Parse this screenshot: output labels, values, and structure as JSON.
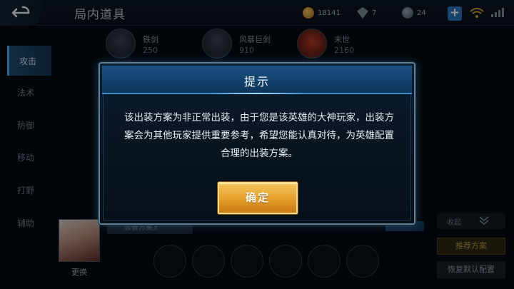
{
  "header": {
    "title": "局内道具",
    "resources": {
      "gold": "18141",
      "gems": "7",
      "vouchers": "24"
    },
    "icons": {
      "back": "back-arrow-icon",
      "gold": "gold-coin-icon",
      "gems": "diamond-icon",
      "vouchers": "voucher-icon",
      "plus": "plus-icon",
      "wifi": "wifi-icon",
      "signal": "signal-icon"
    }
  },
  "sidebar": {
    "items": [
      {
        "label": "攻击",
        "active": true
      },
      {
        "label": "法术",
        "active": false
      },
      {
        "label": "防御",
        "active": false
      },
      {
        "label": "移动",
        "active": false
      },
      {
        "label": "打野",
        "active": false
      },
      {
        "label": "辅助",
        "active": false
      }
    ]
  },
  "equipment": [
    {
      "name": "铁剑",
      "price": "250"
    },
    {
      "name": "风暴巨剑",
      "price": "910"
    },
    {
      "name": "末世",
      "price": "2160"
    }
  ],
  "build_panel": {
    "change_label": "更换",
    "plan_tab_label": "装备方案3",
    "collapse_label": "收起",
    "recommend_label": "推荐方案",
    "restore_label": "恢复默认配置"
  },
  "dialog": {
    "title": "提示",
    "message": "该出装方案为非正常出装，由于您是该英雄的大神玩家，出装方案会为其他玩家提供重要参考，希望您能认真对待，为英雄配置合理的出装方案。",
    "confirm_label": "确定"
  },
  "colors": {
    "accent_blue": "#1c5384",
    "confirm_gold": "#e39e2b",
    "active_tab": "#1f4d74"
  }
}
